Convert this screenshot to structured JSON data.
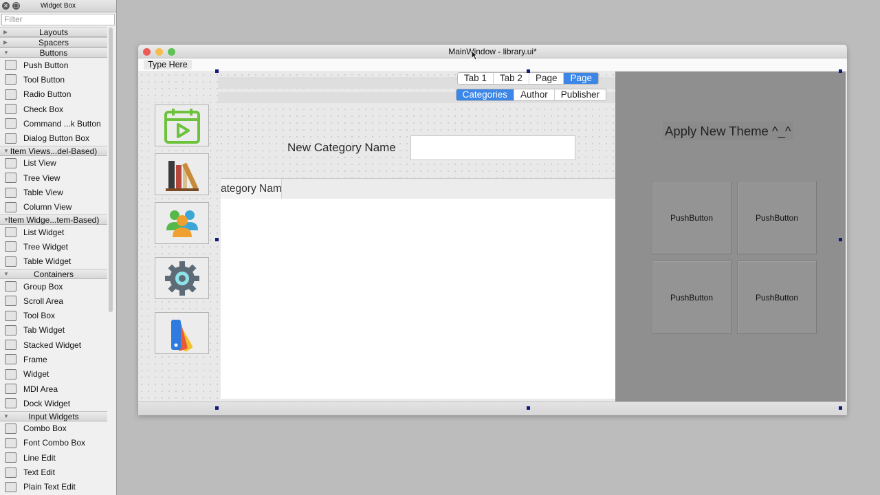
{
  "widget_box": {
    "title": "Widget Box",
    "filter_placeholder": "Filter",
    "categories": [
      {
        "label": "Layouts",
        "expanded": false,
        "items": []
      },
      {
        "label": "Spacers",
        "expanded": false,
        "items": []
      },
      {
        "label": "Buttons",
        "expanded": true,
        "items": [
          {
            "label": "Push Button",
            "icon": "push-button-icon"
          },
          {
            "label": "Tool Button",
            "icon": "tool-button-icon"
          },
          {
            "label": "Radio Button",
            "icon": "radio-button-icon"
          },
          {
            "label": "Check Box",
            "icon": "check-box-icon"
          },
          {
            "label": "Command ...k Button",
            "icon": "command-link-icon"
          },
          {
            "label": "Dialog Button Box",
            "icon": "dialog-button-box-icon"
          }
        ]
      },
      {
        "label": "Item Views...del-Based)",
        "expanded": true,
        "items": [
          {
            "label": "List View",
            "icon": "list-view-icon"
          },
          {
            "label": "Tree View",
            "icon": "tree-view-icon"
          },
          {
            "label": "Table View",
            "icon": "table-view-icon"
          },
          {
            "label": "Column View",
            "icon": "column-view-icon"
          }
        ]
      },
      {
        "label": "Item Widge...tem-Based)",
        "expanded": true,
        "items": [
          {
            "label": "List Widget",
            "icon": "list-widget-icon"
          },
          {
            "label": "Tree Widget",
            "icon": "tree-widget-icon"
          },
          {
            "label": "Table Widget",
            "icon": "table-widget-icon"
          }
        ]
      },
      {
        "label": "Containers",
        "expanded": true,
        "items": [
          {
            "label": "Group Box",
            "icon": "group-box-icon"
          },
          {
            "label": "Scroll Area",
            "icon": "scroll-area-icon"
          },
          {
            "label": "Tool Box",
            "icon": "tool-box-icon"
          },
          {
            "label": "Tab Widget",
            "icon": "tab-widget-icon"
          },
          {
            "label": "Stacked Widget",
            "icon": "stacked-widget-icon"
          },
          {
            "label": "Frame",
            "icon": "frame-icon"
          },
          {
            "label": "Widget",
            "icon": "widget-icon"
          },
          {
            "label": "MDI Area",
            "icon": "mdi-area-icon"
          },
          {
            "label": "Dock Widget",
            "icon": "dock-widget-icon"
          }
        ]
      },
      {
        "label": "Input Widgets",
        "expanded": true,
        "items": [
          {
            "label": "Combo Box",
            "icon": "combo-box-icon"
          },
          {
            "label": "Font Combo Box",
            "icon": "font-combo-box-icon"
          },
          {
            "label": "Line Edit",
            "icon": "line-edit-icon"
          },
          {
            "label": "Text Edit",
            "icon": "text-edit-icon"
          },
          {
            "label": "Plain Text Edit",
            "icon": "plain-text-edit-icon"
          }
        ]
      }
    ]
  },
  "main_window": {
    "title": "MainWindow - library.ui*",
    "menubar": {
      "type_here": "Type Here"
    },
    "top_tabs": [
      "Tab 1",
      "Tab 2",
      "Page",
      "Page"
    ],
    "top_tabs_selected": 3,
    "sub_tabs": [
      "Categories",
      "Author",
      "Publisher"
    ],
    "sub_tabs_selected": 0,
    "new_category_label": "New Category Name",
    "new_category_value": "",
    "table_header": "ategory Nam",
    "theme_label": "Apply New Theme ^_^",
    "push_buttons": [
      "PushButton",
      "PushButton",
      "PushButton",
      "PushButton"
    ],
    "side_icons": [
      "calendar-play-icon",
      "books-icon",
      "users-icon",
      "gear-icon",
      "color-palette-icon"
    ],
    "colors": {
      "accent": "#3b86e6",
      "right_panel": "#8f8f8f",
      "close": "#ed5b56",
      "minimize": "#f5bd4f",
      "zoom": "#5fc453"
    }
  }
}
